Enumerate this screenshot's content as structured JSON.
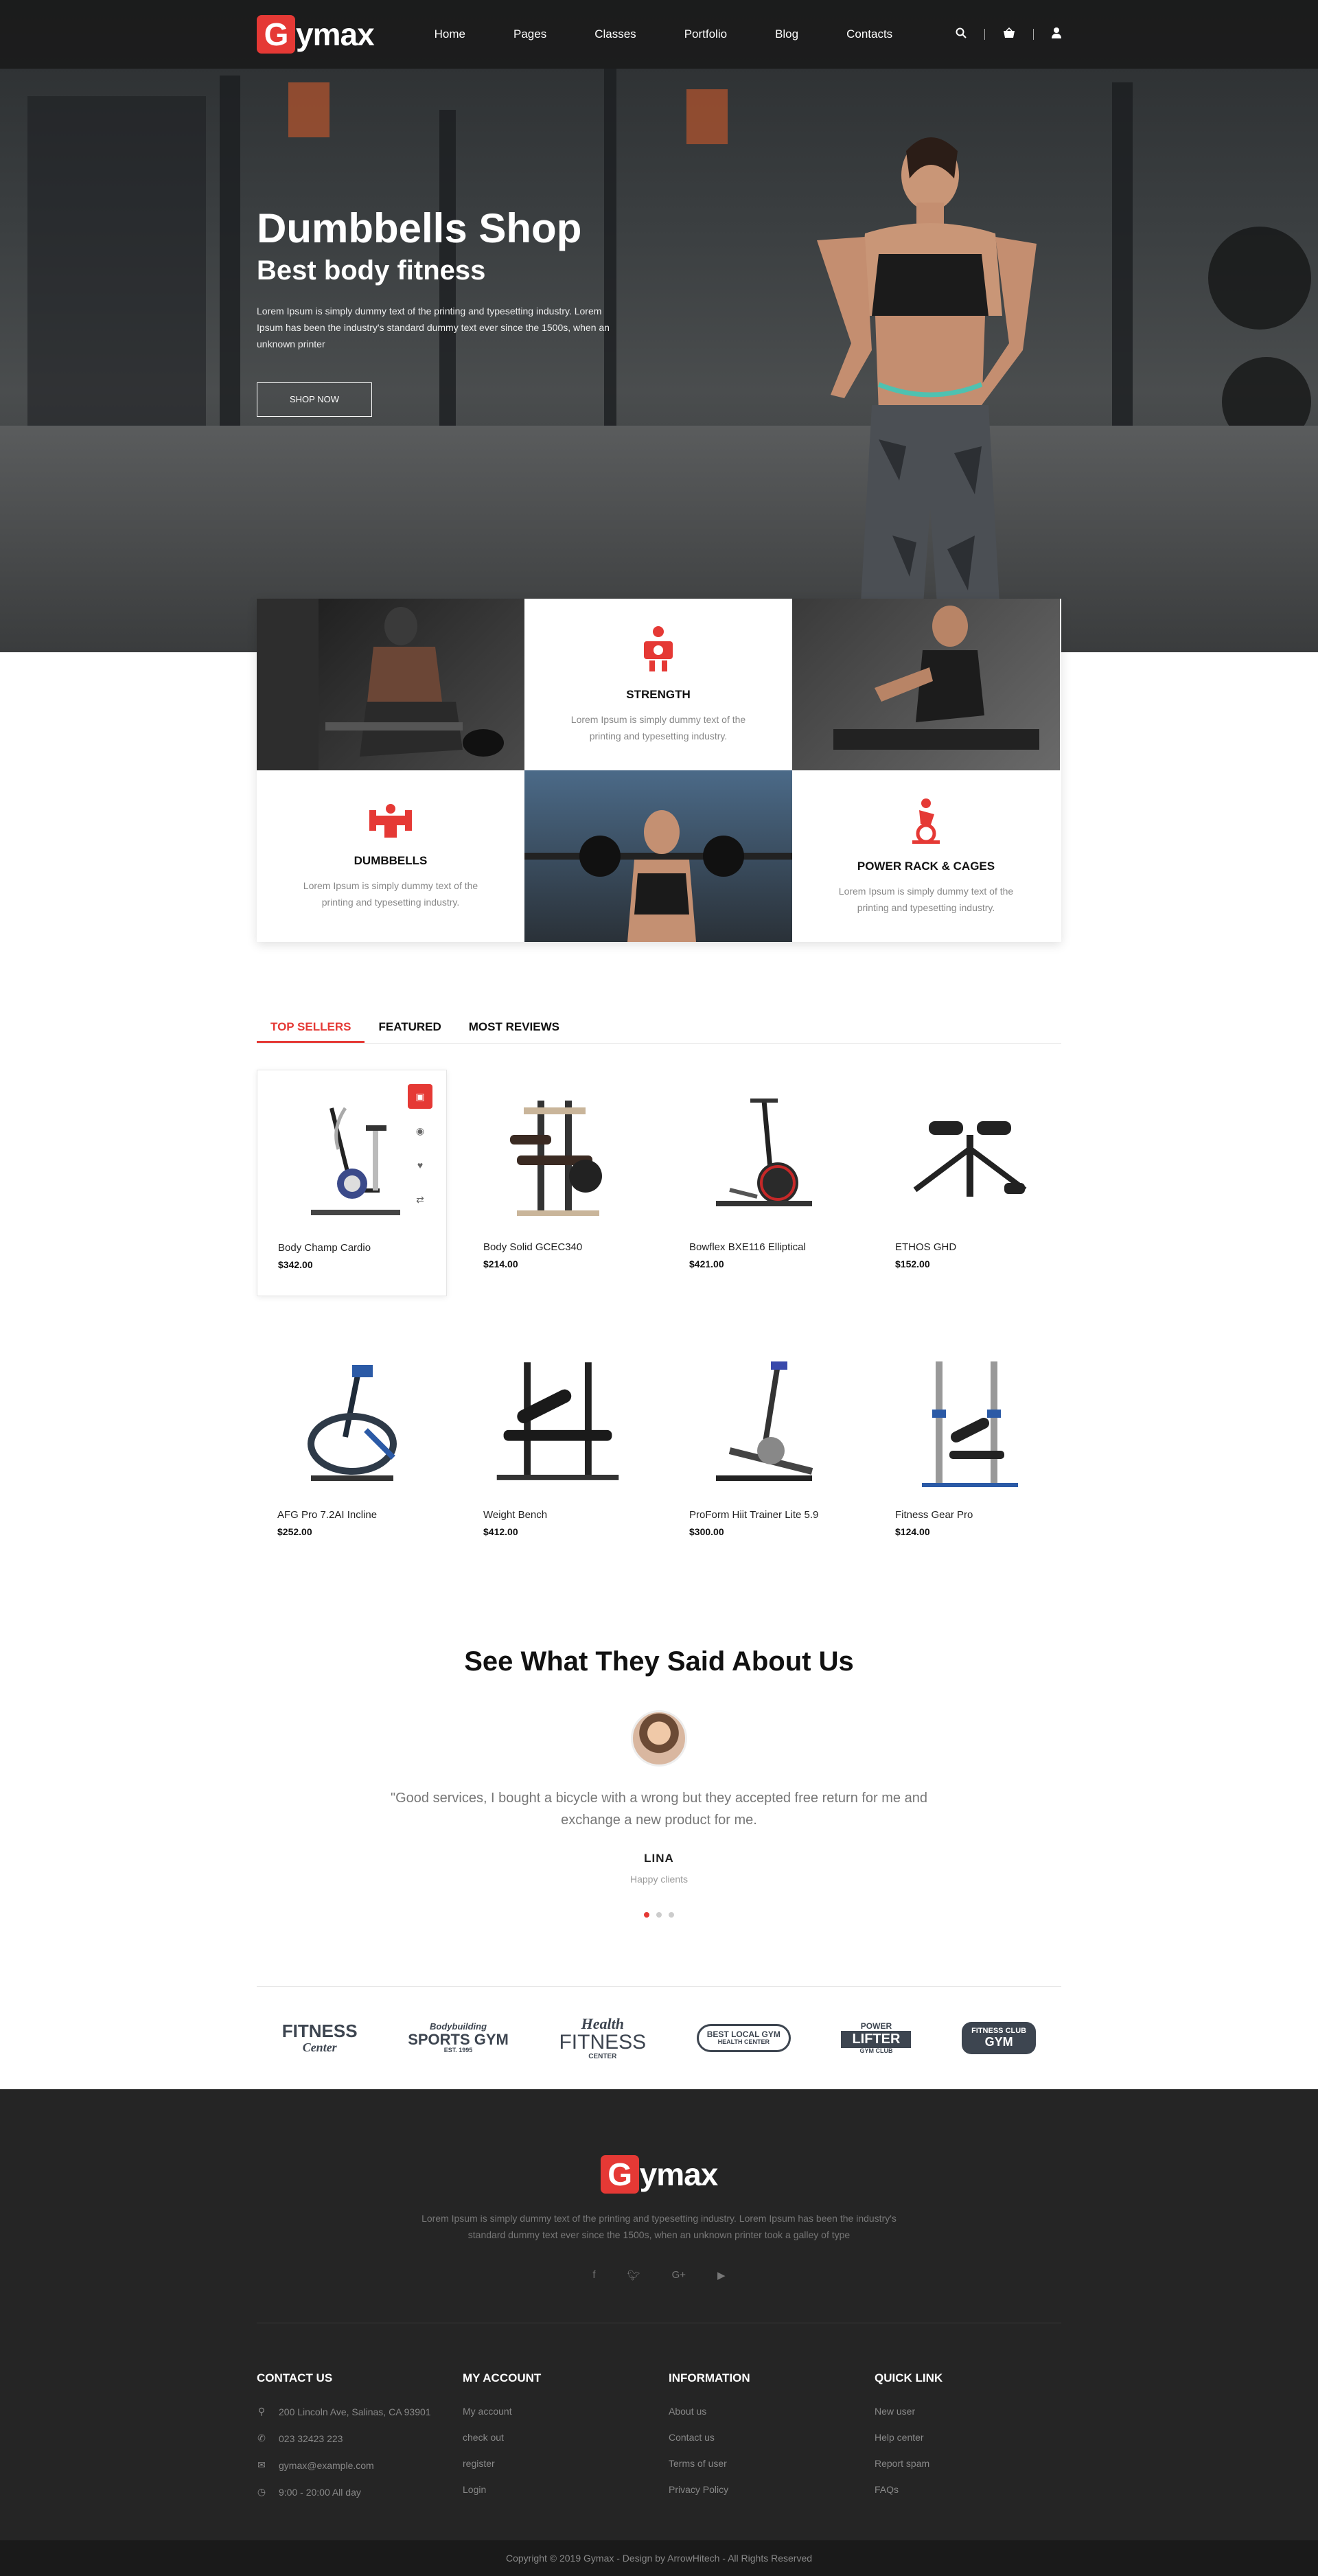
{
  "brand": {
    "logo_letter": "G",
    "logo_rest": "ymax",
    "accent": "#e53935"
  },
  "nav": {
    "items": [
      "Home",
      "Pages",
      "Classes",
      "Portfolio",
      "Blog",
      "Contacts"
    ]
  },
  "header_icons": [
    "search-icon",
    "cart-icon",
    "user-icon"
  ],
  "hero": {
    "title": "Dumbbells Shop",
    "subtitle": "Best body fitness",
    "text": "Lorem Ipsum is simply dummy text of the printing and typesetting industry. Lorem Ipsum has been the industry's standard dummy text ever since the 1500s, when an unknown printer",
    "button": "SHOP NOW"
  },
  "features": [
    {
      "title": "STRENGTH",
      "text": "Lorem Ipsum is simply dummy text of the printing and typesetting industry."
    },
    {
      "title": "DUMBBELLS",
      "text": "Lorem Ipsum is simply dummy text of the printing and typesetting industry."
    },
    {
      "title": "POWER RACK & CAGES",
      "text": "Lorem Ipsum is simply dummy text of the printing and typesetting industry."
    }
  ],
  "tabs": [
    "TOP SELLERS",
    "FEATURED",
    "MOST REVIEWS"
  ],
  "products": [
    {
      "name": "Body Champ Cardio",
      "price": "$342.00"
    },
    {
      "name": "Body Solid GCEC340",
      "price": "$214.00"
    },
    {
      "name": "Bowflex BXE116 Elliptical",
      "price": "$421.00"
    },
    {
      "name": "ETHOS GHD",
      "price": "$152.00"
    },
    {
      "name": "AFG Pro 7.2AI Incline",
      "price": "$252.00"
    },
    {
      "name": "Weight Bench",
      "price": "$412.00"
    },
    {
      "name": "ProForm Hiit Trainer Lite 5.9",
      "price": "$300.00"
    },
    {
      "name": "Fitness Gear Pro",
      "price": "$124.00"
    }
  ],
  "testimonial": {
    "heading": "See What They Said About Us",
    "quote": "\"Good services, I bought a bicycle with a wrong but they accepted free return for me and exchange a new product for me.",
    "name": "LINA",
    "role": "Happy clients"
  },
  "brands": [
    {
      "line1": "FITNESS",
      "line2": "Center"
    },
    {
      "line1": "Bodybuilding",
      "line2": "SPORTS GYM",
      "line3": "EST. 1995"
    },
    {
      "line1": "Health",
      "line2": "FITNESS",
      "line3": "CENTER"
    },
    {
      "line1": "BEST LOCAL GYM",
      "line2": "HEALTH CENTER"
    },
    {
      "line1": "POWER",
      "line2": "LIFTER",
      "line3": "GYM CLUB"
    },
    {
      "line1": "FITNESS CLUB",
      "line2": "GYM"
    }
  ],
  "footer": {
    "about": "Lorem Ipsum is simply dummy text of the printing and typesetting industry. Lorem Ipsum has been the industry's standard dummy text ever since the 1500s, when an unknown printer took a galley of type",
    "social": [
      "facebook-icon",
      "twitter-icon",
      "google-plus-icon",
      "youtube-icon"
    ],
    "contact": {
      "title": "CONTACT US",
      "address": "200 Lincoln Ave, Salinas, CA 93901",
      "phone": "023 32423 223",
      "email": "gymax@example.com",
      "hours": "9:00 - 20:00 All day"
    },
    "account": {
      "title": "MY ACCOUNT",
      "items": [
        "My account",
        "check out",
        "register",
        "Login"
      ]
    },
    "information": {
      "title": "INFORMATION",
      "items": [
        "About us",
        "Contact us",
        "Terms of user",
        "Privacy Policy"
      ]
    },
    "quick": {
      "title": "QUICK LINK",
      "items": [
        "New user",
        "Help center",
        "Report spam",
        "FAQs"
      ]
    },
    "copyright": "Copyright © 2019 Gymax - Design by ArrowHitech - All Rights Reserved"
  }
}
